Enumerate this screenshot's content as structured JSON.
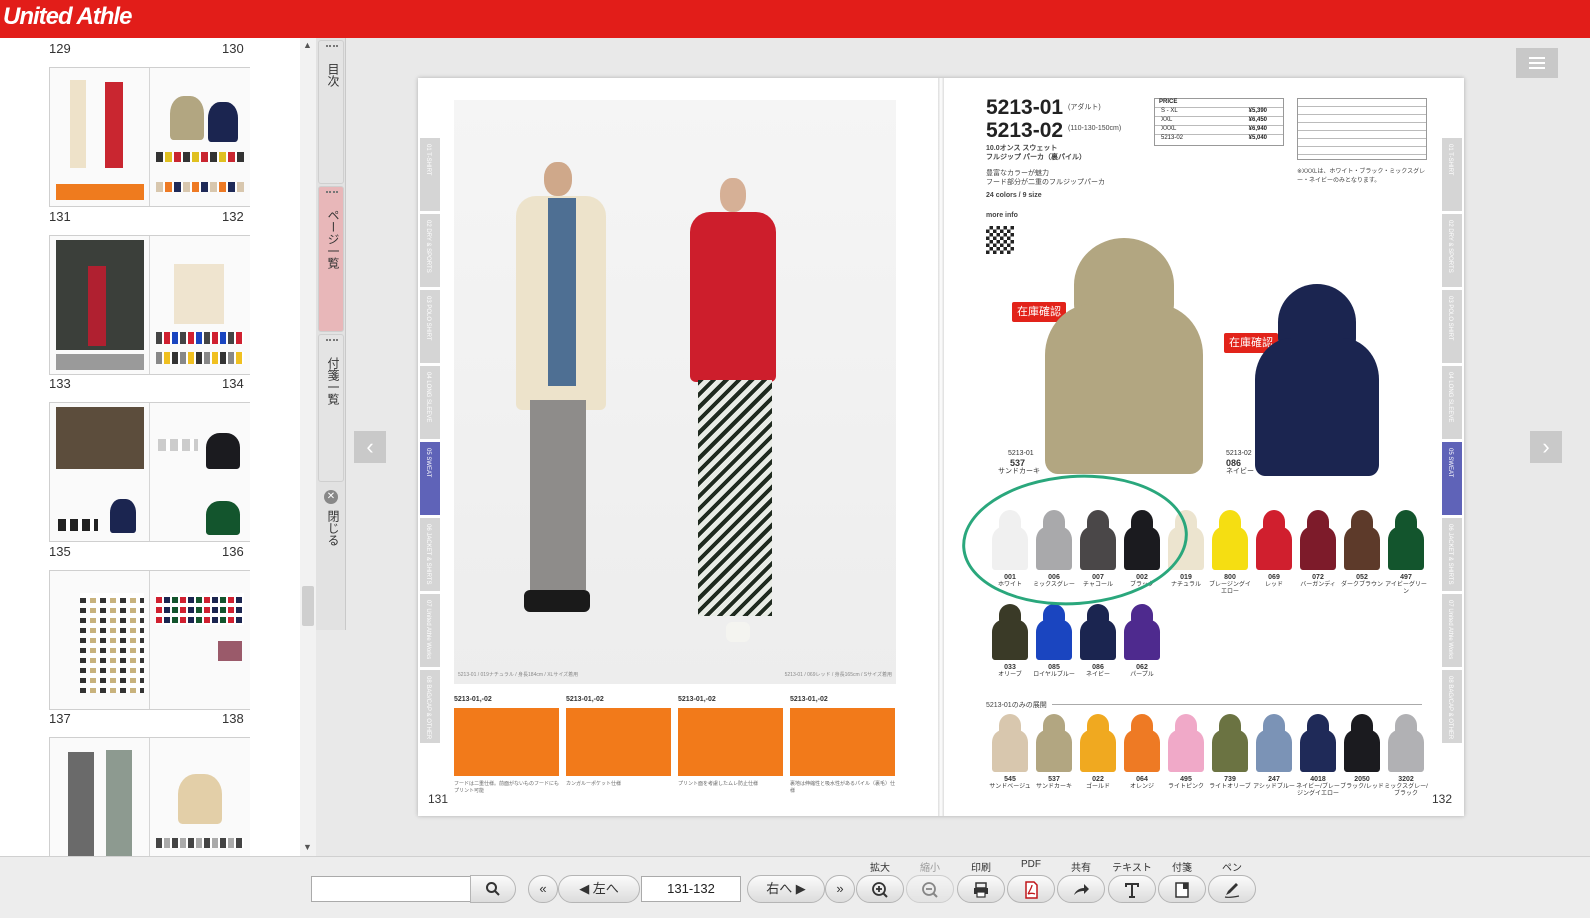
{
  "header": {
    "logo_text": "United Athle"
  },
  "sidebar": {
    "thumbnails": [
      {
        "left": "129",
        "right": "130"
      },
      {
        "left": "131",
        "right": "132"
      },
      {
        "left": "133",
        "right": "134"
      },
      {
        "left": "135",
        "right": "136"
      },
      {
        "left": "137",
        "right": "138"
      }
    ],
    "tabs": {
      "contents": "目次",
      "page_list": "ページ一覧",
      "sticky_list": "付箋一覧",
      "close": "閉じる"
    }
  },
  "book": {
    "left_page": {
      "folio": "131",
      "photo_caption_left": "5213-01 / 019ナチュラル / 身長184cm / XLサイズ着用",
      "photo_caption_right": "5213-01 / 069レッド / 身長165cm / Sサイズ着用",
      "details": [
        {
          "code": "5213-01,-02",
          "caption": "フードは二重仕様。前面がないものフードにもプリント可能"
        },
        {
          "code": "5213-01,-02",
          "caption": "カンガルーポケット仕様"
        },
        {
          "code": "5213-01,-02",
          "caption": "プリント面を考慮したムレ防止仕様"
        },
        {
          "code": "5213-01,-02",
          "caption": "裏地は伸縮性と吸水性があるパイル（裏毛）仕様"
        }
      ]
    },
    "right_page": {
      "folio": "132",
      "code1": "5213-01",
      "code1_note": "(アダルト)",
      "code2": "5213-02",
      "code2_note": "(110-130-150cm)",
      "name_line1": "10.0オンス スウェット",
      "name_line2": "フルジップ パーカ（裏パイル）",
      "desc1": "豊富なカラーが魅力",
      "desc2": "フード部分が二重のフルジップパーカ",
      "colors_size": "24 colors / 9 size",
      "more_info": "more info",
      "price_header": "PRICE",
      "prices": [
        {
          "size": "S - XL",
          "price": "¥5,390"
        },
        {
          "size": "XXL",
          "price": "¥6,450"
        },
        {
          "size": "XXXL",
          "price": "¥6,940"
        },
        {
          "size": "5213-02",
          "price": "¥5,040"
        }
      ],
      "price_note": "※XXXLは、ホワイト・ブラック・ミックスグレー・ネイビーのみとなります。",
      "stock_label": "在庫確認",
      "main_items": [
        {
          "model": "5213-01",
          "code": "537",
          "color": "サンドカーキ"
        },
        {
          "model": "5213-02",
          "code": "086",
          "color": "ネイビー"
        }
      ],
      "swatches_row1": [
        {
          "code": "001",
          "name": "ホワイト",
          "hex": "#f0f0f0"
        },
        {
          "code": "006",
          "name": "ミックスグレー",
          "hex": "#a9a9ab"
        },
        {
          "code": "007",
          "name": "チャコール",
          "hex": "#4a4748"
        },
        {
          "code": "002",
          "name": "ブラック",
          "hex": "#1b1b1f"
        },
        {
          "code": "019",
          "name": "ナチュラル",
          "hex": "#ece4cf"
        },
        {
          "code": "800",
          "name": "ブレージングイエロー",
          "hex": "#f5de12"
        },
        {
          "code": "069",
          "name": "レッド",
          "hex": "#d01f2e"
        },
        {
          "code": "072",
          "name": "バーガンディ",
          "hex": "#7d1b2a"
        },
        {
          "code": "052",
          "name": "ダークブラウン",
          "hex": "#5d3a2a"
        },
        {
          "code": "497",
          "name": "アイビーグリーン",
          "hex": "#13552d"
        }
      ],
      "swatches_row2": [
        {
          "code": "033",
          "name": "オリーブ",
          "hex": "#3a3a27"
        },
        {
          "code": "085",
          "name": "ロイヤルブルー",
          "hex": "#1a45c0"
        },
        {
          "code": "086",
          "name": "ネイビー",
          "hex": "#1b2550"
        },
        {
          "code": "062",
          "name": "パープル",
          "hex": "#4e2a8e"
        }
      ],
      "only_label": "5213-01のみの展開",
      "swatches_row3": [
        {
          "code": "545",
          "name": "サンドベージュ",
          "hex": "#d8c7ae"
        },
        {
          "code": "537",
          "name": "サンドカーキ",
          "hex": "#b2a681"
        },
        {
          "code": "022",
          "name": "ゴールド",
          "hex": "#f0a920"
        },
        {
          "code": "064",
          "name": "オレンジ",
          "hex": "#ee7a24"
        },
        {
          "code": "495",
          "name": "ライトピンク",
          "hex": "#f0a9c8"
        },
        {
          "code": "739",
          "name": "ライトオリーブ",
          "hex": "#6b7342"
        },
        {
          "code": "247",
          "name": "アシッドブルー",
          "hex": "#7b93b6"
        },
        {
          "code": "4018",
          "name": "ネイビー/ブレージングイエロー",
          "hex": "#1f2a58"
        },
        {
          "code": "2050",
          "name": "ブラック/レッド",
          "hex": "#1b1b1f"
        },
        {
          "code": "3202",
          "name": "ミックスグレー/ブラック",
          "hex": "#b1b1b4"
        }
      ]
    },
    "index_tabs": [
      "01 T-SHIRT",
      "02 DRY & SPORTS",
      "03 POLO SHIRT",
      "04 LONG SLEEVE",
      "05 SWEAT",
      "06 JACKET & SHIRTS",
      "07 United Athle Works",
      "08 BAG/CAP & OTHER"
    ]
  },
  "toolbar": {
    "search_placeholder": "",
    "first_label": "«",
    "prev_label": "◀ 左へ",
    "page_value": "131-132",
    "next_label": "右へ ▶",
    "last_label": "»",
    "labels": {
      "zoom_in": "拡大",
      "zoom_out": "縮小",
      "print": "印刷",
      "pdf": "PDF",
      "share": "共有",
      "text": "テキスト",
      "sticky": "付箋",
      "pen": "ペン"
    }
  },
  "colors": {
    "brand_red": "#e21d19",
    "active_tab": "#e8b7b9",
    "index_active": "#5f63b8",
    "highlight_circle": "#2aa77c"
  }
}
